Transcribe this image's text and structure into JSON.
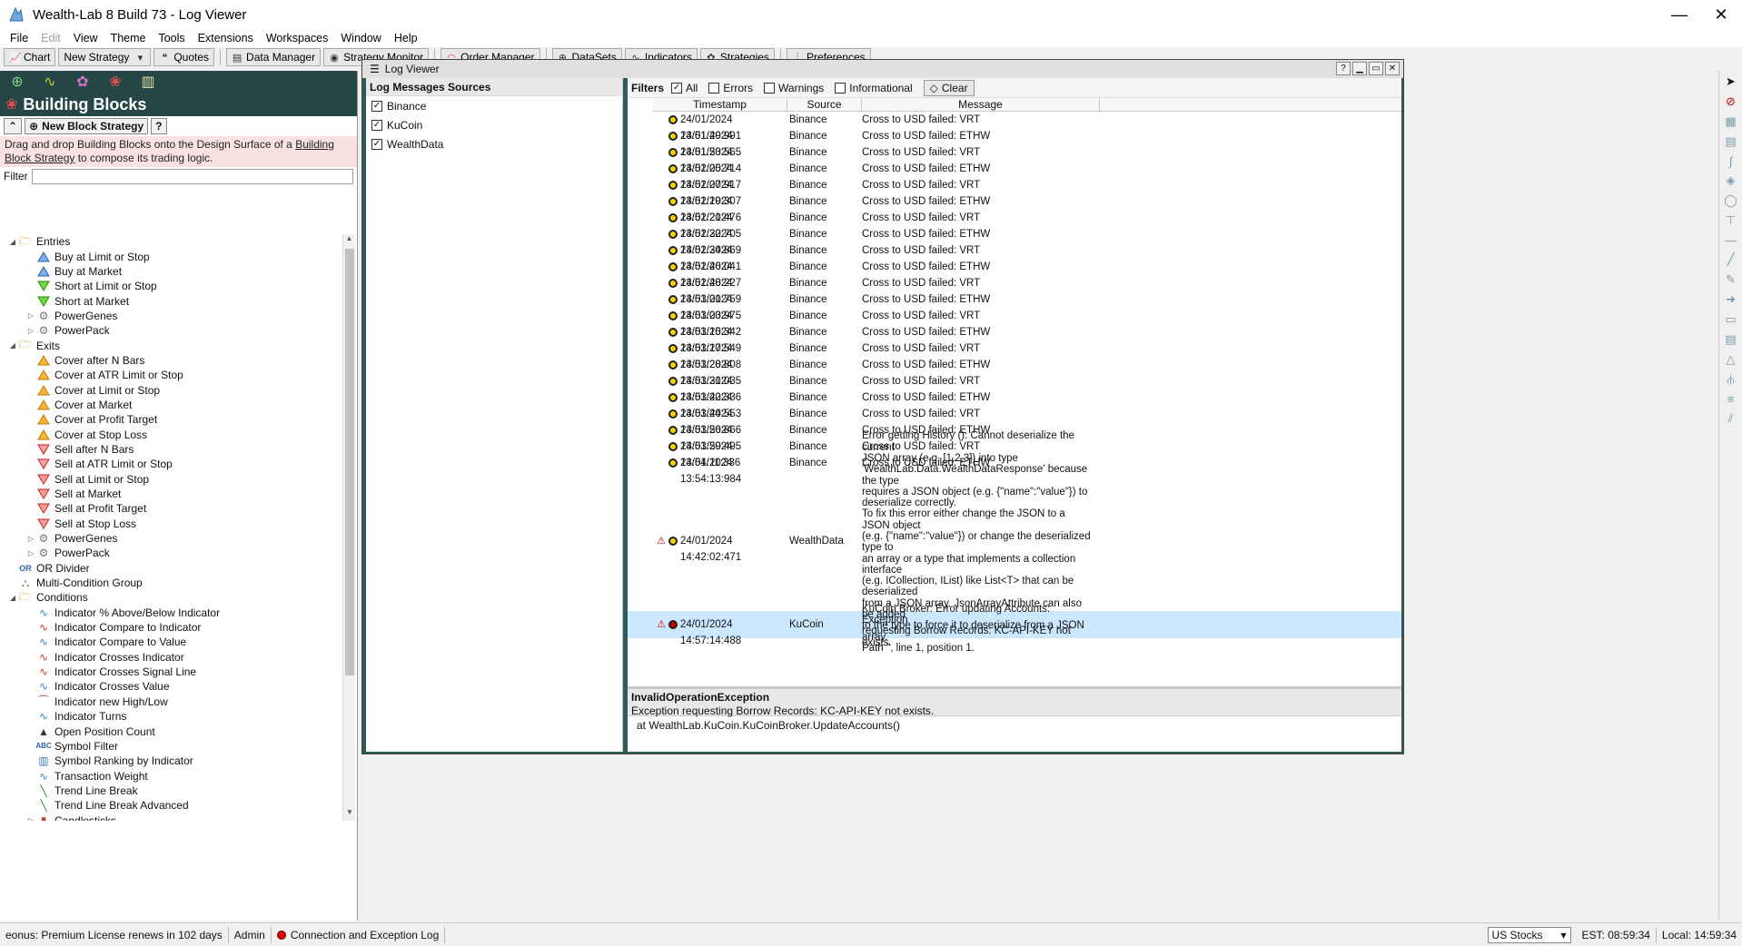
{
  "window": {
    "title": "Wealth-Lab 8 Build 73 - Log Viewer"
  },
  "menu": [
    "File",
    "Edit",
    "View",
    "Theme",
    "Tools",
    "Extensions",
    "Workspaces",
    "Window",
    "Help"
  ],
  "toolbar": {
    "chart": "Chart",
    "new_strategy": "New Strategy",
    "quotes": "Quotes",
    "data_manager": "Data Manager",
    "strategy_monitor": "Strategy Monitor",
    "order_manager": "Order Manager",
    "datasets": "DataSets",
    "indicators": "Indicators",
    "strategies": "Strategies",
    "preferences": "Preferences"
  },
  "building_blocks": {
    "title": "Building Blocks",
    "new_block_strategy": "New Block Strategy",
    "help": "?",
    "desc_pre": "Drag and drop Building Blocks onto the Design Surface of a ",
    "desc_link": "Building Block Strategy",
    "desc_post": " to compose its trading logic.",
    "filter_label": "Filter",
    "tree": [
      {
        "label": "Entries",
        "level": 0,
        "exp": "▲",
        "icon": "folder"
      },
      {
        "label": "Buy at Limit or Stop",
        "level": 1,
        "icon": "tri-blue"
      },
      {
        "label": "Buy at Market",
        "level": 1,
        "icon": "tri-blue"
      },
      {
        "label": "Short at Limit or Stop",
        "level": 1,
        "icon": "tri-green"
      },
      {
        "label": "Short at Market",
        "level": 1,
        "icon": "tri-green"
      },
      {
        "label": "PowerGenes",
        "level": 1,
        "exp": "▷",
        "icon": "gear"
      },
      {
        "label": "PowerPack",
        "level": 1,
        "exp": "▷",
        "icon": "gear"
      },
      {
        "label": "Exits",
        "level": 0,
        "exp": "▲",
        "icon": "folder"
      },
      {
        "label": "Cover after N Bars",
        "level": 1,
        "icon": "tri-orange"
      },
      {
        "label": "Cover at ATR Limit or Stop",
        "level": 1,
        "icon": "tri-orange"
      },
      {
        "label": "Cover at Limit or Stop",
        "level": 1,
        "icon": "tri-orange"
      },
      {
        "label": "Cover at Market",
        "level": 1,
        "icon": "tri-orange"
      },
      {
        "label": "Cover at Profit Target",
        "level": 1,
        "icon": "tri-orange"
      },
      {
        "label": "Cover at Stop Loss",
        "level": 1,
        "icon": "tri-orange"
      },
      {
        "label": "Sell after N Bars",
        "level": 1,
        "icon": "tri-red"
      },
      {
        "label": "Sell at ATR Limit or Stop",
        "level": 1,
        "icon": "tri-red"
      },
      {
        "label": "Sell at Limit or Stop",
        "level": 1,
        "icon": "tri-red"
      },
      {
        "label": "Sell at Market",
        "level": 1,
        "icon": "tri-red"
      },
      {
        "label": "Sell at Profit Target",
        "level": 1,
        "icon": "tri-red"
      },
      {
        "label": "Sell at Stop Loss",
        "level": 1,
        "icon": "tri-red"
      },
      {
        "label": "PowerGenes",
        "level": 1,
        "exp": "▷",
        "icon": "gear"
      },
      {
        "label": "PowerPack",
        "level": 1,
        "exp": "▷",
        "icon": "gear"
      },
      {
        "label": "OR Divider",
        "level": 0,
        "icon": "or"
      },
      {
        "label": "Multi-Condition Group",
        "level": 0,
        "icon": "group"
      },
      {
        "label": "Conditions",
        "level": 0,
        "exp": "▲",
        "icon": "folder"
      },
      {
        "label": "Indicator % Above/Below Indicator",
        "level": 1,
        "icon": "wave"
      },
      {
        "label": "Indicator Compare to Indicator",
        "level": 1,
        "icon": "wave2"
      },
      {
        "label": "Indicator Compare to Value",
        "level": 1,
        "icon": "wave"
      },
      {
        "label": "Indicator Crosses Indicator",
        "level": 1,
        "icon": "wave2"
      },
      {
        "label": "Indicator Crosses Signal Line",
        "level": 1,
        "icon": "wave2"
      },
      {
        "label": "Indicator Crosses Value",
        "level": 1,
        "icon": "wave"
      },
      {
        "label": "Indicator new High/Low",
        "level": 1,
        "icon": "wave3"
      },
      {
        "label": "Indicator Turns",
        "level": 1,
        "icon": "wave"
      },
      {
        "label": "Open Position Count",
        "level": 1,
        "icon": "count"
      },
      {
        "label": "Symbol Filter",
        "level": 1,
        "icon": "abc"
      },
      {
        "label": "Symbol Ranking by Indicator",
        "level": 1,
        "icon": "bars"
      },
      {
        "label": "Transaction Weight",
        "level": 1,
        "icon": "wave"
      },
      {
        "label": "Trend Line Break",
        "level": 1,
        "icon": "trend"
      },
      {
        "label": "Trend Line Break Advanced",
        "level": 1,
        "icon": "trend"
      },
      {
        "label": "Candlesticks",
        "level": 1,
        "exp": "▷",
        "icon": "candle"
      }
    ]
  },
  "log_viewer": {
    "title": "Log Viewer",
    "sources_header": "Log Messages Sources",
    "sources": [
      "Binance",
      "KuCoin",
      "WealthData"
    ],
    "filters": {
      "label": "Filters",
      "all": "All",
      "errors": "Errors",
      "warnings": "Warnings",
      "informational": "Informational",
      "clear": "Clear"
    },
    "columns": {
      "timestamp": "Timestamp",
      "source": "Source",
      "message": "Message"
    },
    "rows": [
      {
        "ts": "24/01/2024 13:51:49:991",
        "src": "Binance",
        "msg": "Cross to USD failed: VRT",
        "level": "warn"
      },
      {
        "ts": "24/01/2024 13:51:53:565",
        "src": "Binance",
        "msg": "Cross to USD failed: ETHW",
        "level": "warn"
      },
      {
        "ts": "24/01/2024 13:52:05:714",
        "src": "Binance",
        "msg": "Cross to USD failed: VRT",
        "level": "warn"
      },
      {
        "ts": "24/01/2024 13:52:07:917",
        "src": "Binance",
        "msg": "Cross to USD failed: ETHW",
        "level": "warn"
      },
      {
        "ts": "24/01/2024 13:52:19:307",
        "src": "Binance",
        "msg": "Cross to USD failed: VRT",
        "level": "warn"
      },
      {
        "ts": "24/01/2024 13:52:21:476",
        "src": "Binance",
        "msg": "Cross to USD failed: ETHW",
        "level": "warn"
      },
      {
        "ts": "24/01/2024 13:52:32:705",
        "src": "Binance",
        "msg": "Cross to USD failed: VRT",
        "level": "warn"
      },
      {
        "ts": "24/01/2024 13:52:34:869",
        "src": "Binance",
        "msg": "Cross to USD failed: ETHW",
        "level": "warn"
      },
      {
        "ts": "24/01/2024 13:52:46:041",
        "src": "Binance",
        "msg": "Cross to USD failed: VRT",
        "level": "warn"
      },
      {
        "ts": "24/01/2024 13:52:48:227",
        "src": "Binance",
        "msg": "Cross to USD failed: ETHW",
        "level": "warn"
      },
      {
        "ts": "24/01/2024 13:53:01:759",
        "src": "Binance",
        "msg": "Cross to USD failed: VRT",
        "level": "warn"
      },
      {
        "ts": "24/01/2024 13:53:03:975",
        "src": "Binance",
        "msg": "Cross to USD failed: ETHW",
        "level": "warn"
      },
      {
        "ts": "24/01/2024 13:53:15:342",
        "src": "Binance",
        "msg": "Cross to USD failed: VRT",
        "level": "warn"
      },
      {
        "ts": "24/01/2024 13:53:17:549",
        "src": "Binance",
        "msg": "Cross to USD failed: ETHW",
        "level": "warn"
      },
      {
        "ts": "24/01/2024 13:53:28:808",
        "src": "Binance",
        "msg": "Cross to USD failed: VRT",
        "level": "warn"
      },
      {
        "ts": "24/01/2024 13:53:31:035",
        "src": "Binance",
        "msg": "Cross to USD failed: ETHW",
        "level": "warn"
      },
      {
        "ts": "24/01/2024 13:53:42:336",
        "src": "Binance",
        "msg": "Cross to USD failed: VRT",
        "level": "warn"
      },
      {
        "ts": "24/01/2024 13:53:44:553",
        "src": "Binance",
        "msg": "Cross to USD failed: ETHW",
        "level": "warn"
      },
      {
        "ts": "24/01/2024 13:53:56:866",
        "src": "Binance",
        "msg": "Cross to USD failed: VRT",
        "level": "warn"
      },
      {
        "ts": "24/01/2024 13:53:59:495",
        "src": "Binance",
        "msg": "Cross to USD failed: ETHW",
        "level": "warn"
      },
      {
        "ts": "24/01/2024 13:54:11:336",
        "src": "Binance",
        "msg": "Cross to USD failed: VRT",
        "level": "warn"
      },
      {
        "ts": "24/01/2024 13:54:13:984",
        "src": "Binance",
        "msg": "Cross to USD failed: ETHW",
        "level": "warn"
      }
    ],
    "long_row": {
      "ts": "24/01/2024 14:42:02:471",
      "src": "WealthData",
      "level": "warn",
      "lines": [
        "Error getting History (): Cannot deserialize the current",
        "JSON array (e.g. [1,2,3]) into type",
        "'WealthLab.Data.WealthDataResponse' because the type",
        "requires a JSON object (e.g. {\"name\":\"value\"}) to",
        "deserialize correctly.",
        "To fix this error either change the JSON to a JSON object",
        "(e.g. {\"name\":\"value\"}) or change the deserialized type to",
        "an array or a type that implements a collection interface",
        "(e.g. ICollection, IList) like List<T> that can be deserialized",
        "from a JSON array. JsonArrayAttribute can also be added",
        "to the type to force it to deserialize from a JSON array.",
        "Path '', line 1, position 1."
      ]
    },
    "selected_row": {
      "ts": "24/01/2024 14:57:14:488",
      "src": "KuCoin",
      "level": "err",
      "lines": [
        "KuCoin Broker: Error updating Accounts: Exception",
        "requesting Borrow Records: KC-API-KEY not exists."
      ]
    },
    "detail": {
      "exception": "InvalidOperationException",
      "message": "Exception requesting Borrow Records: KC-API-KEY not exists.",
      "stack": "at WealthLab.KuCoin.KuCoinBroker.UpdateAccounts()"
    }
  },
  "status": {
    "license": "eonus: Premium License renews in 102 days",
    "user": "Admin",
    "log": "Connection and Exception Log",
    "market": "US Stocks",
    "est": "EST: 08:59:34",
    "local": "Local: 14:59:34"
  },
  "colors": {
    "accent_dark": "#264646",
    "selected_row": "#cce8ff",
    "warn": "#f5d000",
    "error": "#cc0000"
  }
}
